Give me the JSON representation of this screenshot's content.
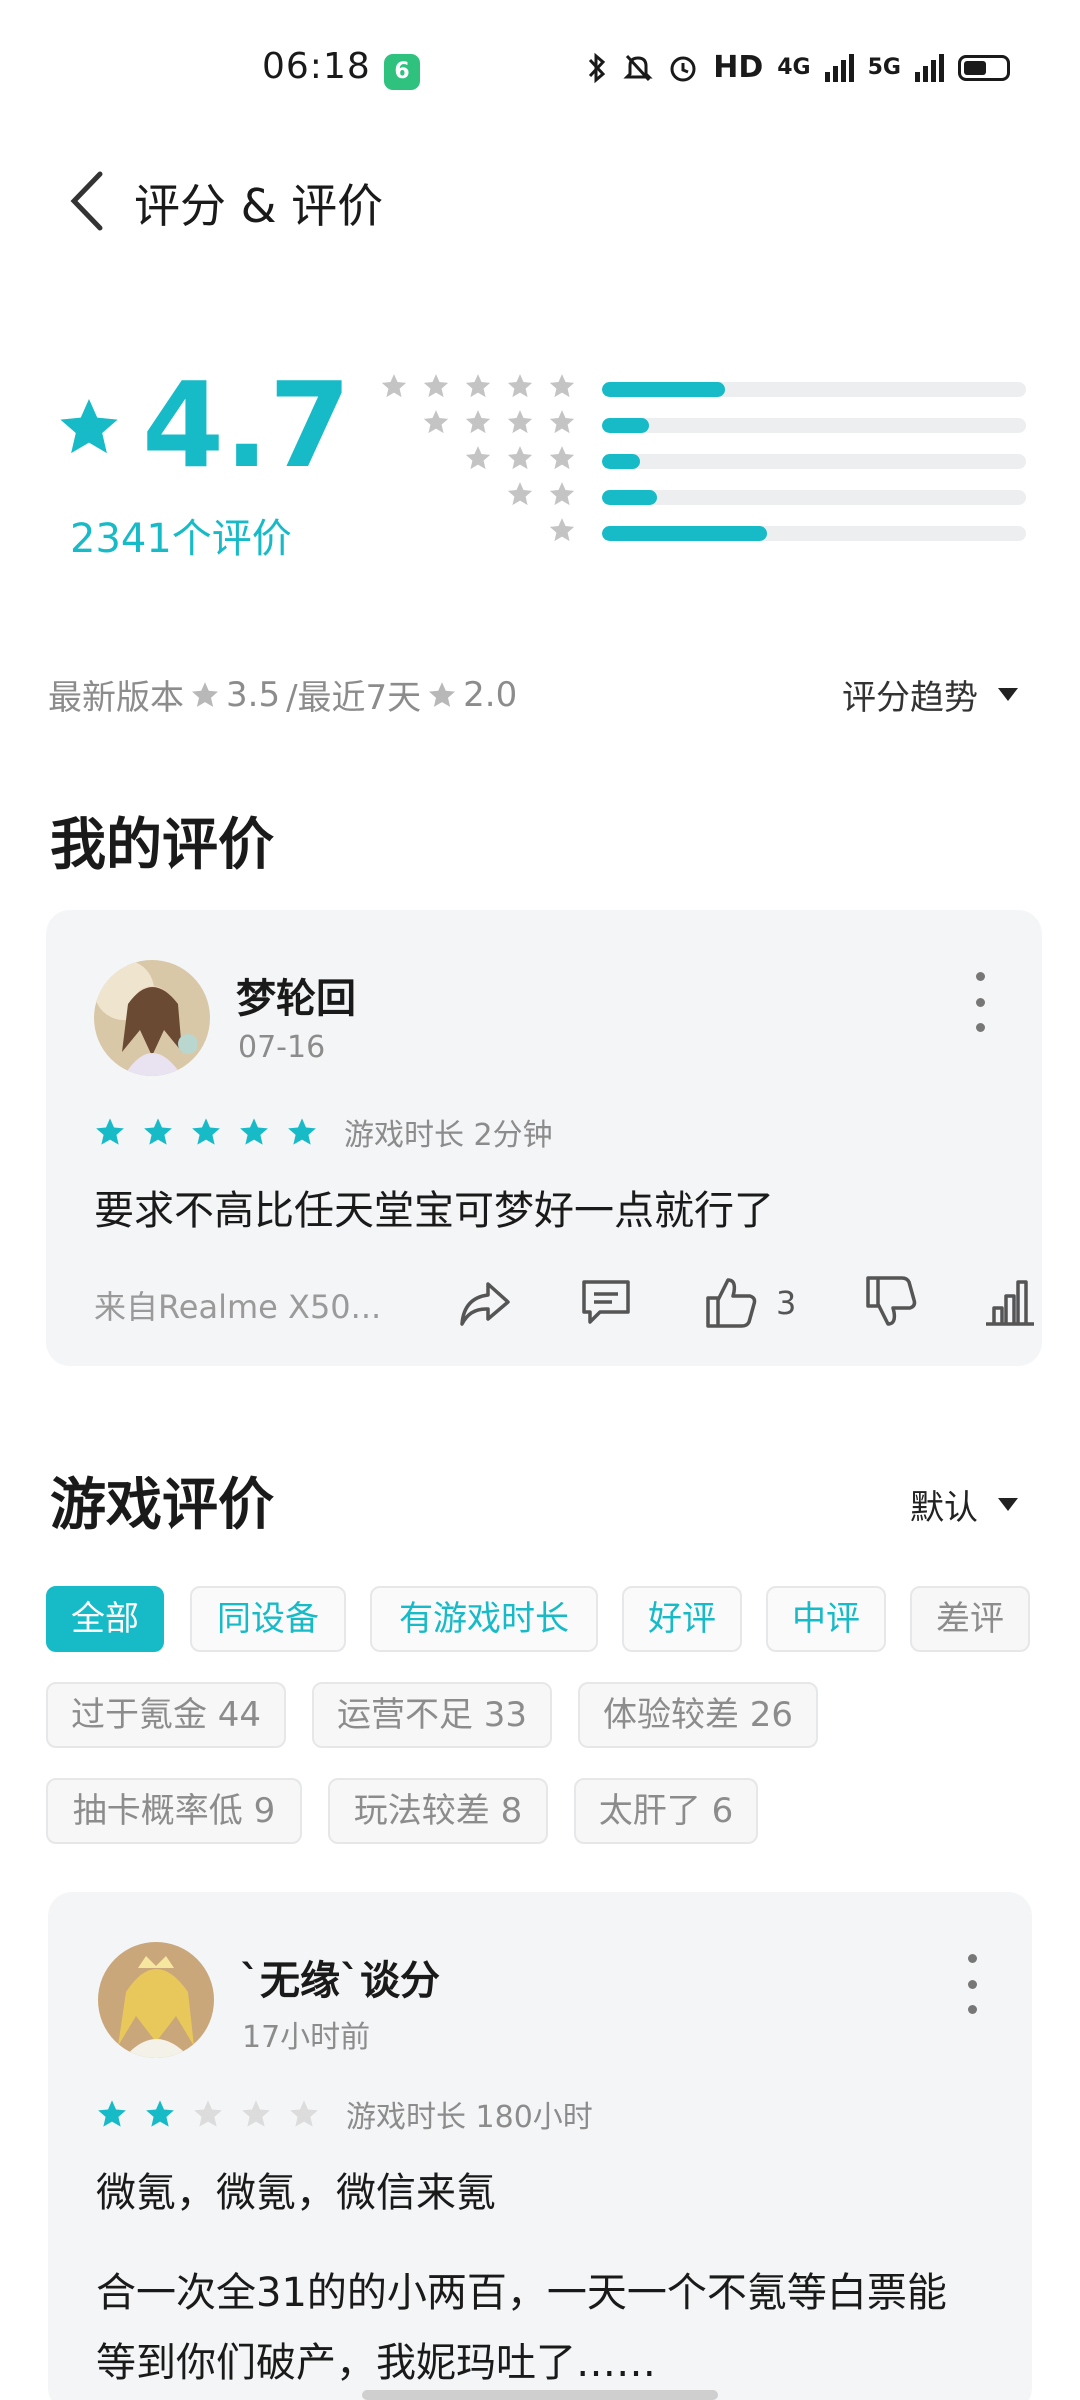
{
  "status_bar": {
    "time": "06:18",
    "app_icon": "6",
    "hd": "HD",
    "net1": "4G",
    "net2": "5G"
  },
  "header": {
    "title": "评分 & 评价"
  },
  "summary": {
    "score": "4.7",
    "count_label": "2341个评价",
    "distribution": [
      {
        "stars": 5,
        "fraction": 0.29
      },
      {
        "stars": 4,
        "fraction": 0.11
      },
      {
        "stars": 3,
        "fraction": 0.09
      },
      {
        "stars": 2,
        "fraction": 0.13
      },
      {
        "stars": 1,
        "fraction": 0.39
      }
    ]
  },
  "version_line": {
    "prefix": "最新版本",
    "latest_score": "3.5",
    "separator": "/最近7天",
    "recent_score": "2.0"
  },
  "trend_button": "评分趋势",
  "my_review": {
    "section_title": "我的评价",
    "user": "梦轮回",
    "date": "07-16",
    "stars": 5,
    "play_time": "游戏时长 2分钟",
    "text": "要求不高比任天堂宝可梦好一点就行了",
    "device": "来自Realme X50...",
    "likes": "3"
  },
  "game_reviews": {
    "section_title": "游戏评价",
    "sort_label": "默认",
    "filter_chips": [
      "全部",
      "同设备",
      "有游戏时长",
      "好评",
      "中评",
      "差评"
    ],
    "tag_chips": [
      "过于氪金 44",
      "运营不足 33",
      "体验较差 26",
      "抽卡概率低 9",
      "玩法较差 8",
      "太肝了 6"
    ]
  },
  "review_1": {
    "user": "`无缘`谈分",
    "time": "17小时前",
    "stars": 2,
    "play_time": "游戏时长 180小时",
    "line1": "微氪，微氪，微信来氪",
    "line2": "合一次全31的的小两百，一天一个不氪等白票能",
    "line3": "等到你们破产，我妮玛吐了……"
  },
  "colors": {
    "accent": "#17bac7",
    "star_empty": "#dcdcdc",
    "card_bg": "#f4f5f7"
  }
}
